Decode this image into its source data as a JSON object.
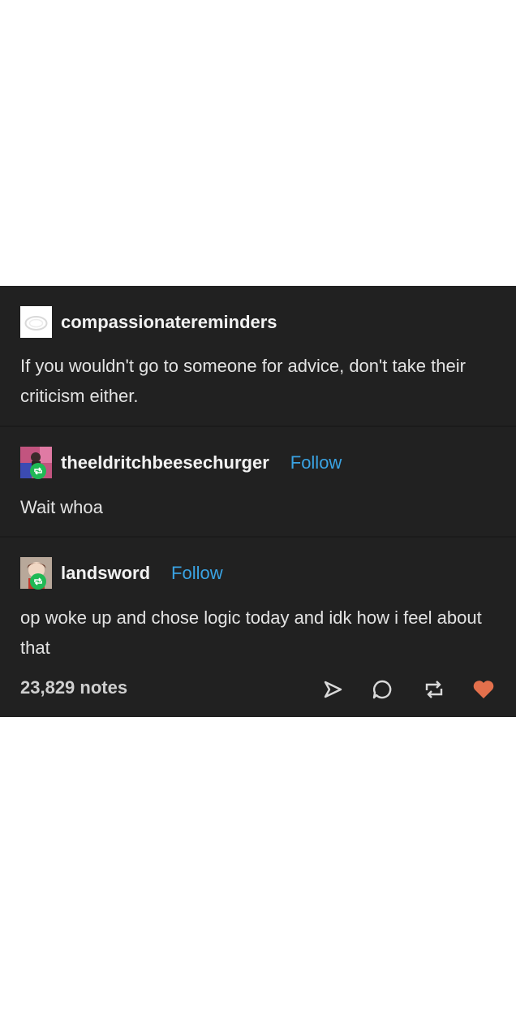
{
  "posts": [
    {
      "username": "compassionatereminders",
      "text": "If you wouldn't go to someone for advice, don't take their criticism either."
    },
    {
      "username": "theeldritchbeesechurger",
      "follow_label": "Follow",
      "text": "Wait whoa"
    },
    {
      "username": "landsword",
      "follow_label": "Follow",
      "text": "op woke up and chose logic today and idk how i feel about that"
    }
  ],
  "footer": {
    "notes": "23,829 notes"
  },
  "icons": {
    "share": "send-icon",
    "reply": "comment-icon",
    "reblog": "reblog-icon",
    "like": "heart-icon"
  },
  "colors": {
    "background": "#212121",
    "follow": "#3aa3e3",
    "reblog_badge": "#1fb955",
    "heart": "#e3704c"
  }
}
